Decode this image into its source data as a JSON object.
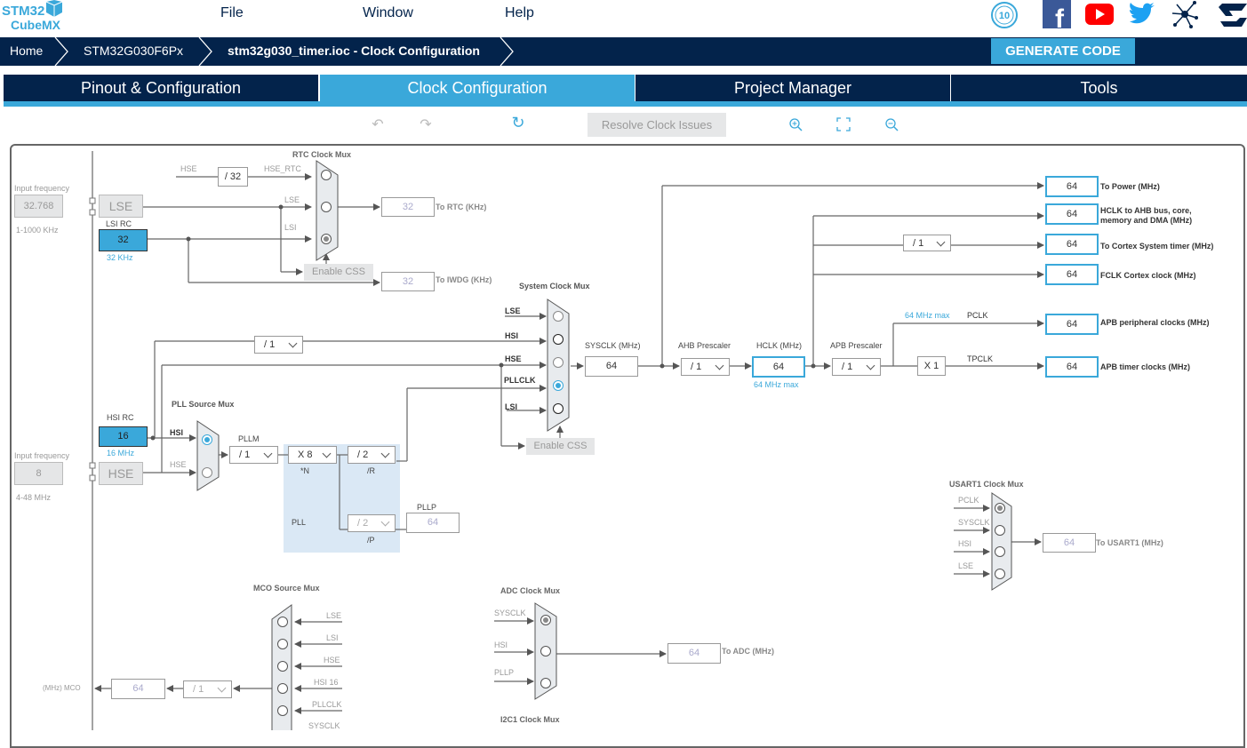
{
  "header": {
    "logo_line1": "STM32",
    "logo_line2": "CubeMX",
    "menu": [
      "File",
      "Window",
      "Help"
    ],
    "social_icons": [
      "anniversary-10-years-icon",
      "facebook-icon",
      "youtube-icon",
      "twitter-icon",
      "network-icon",
      "st-logo-icon"
    ]
  },
  "breadcrumb": [
    "Home",
    "STM32G030F6Px",
    "stm32g030_timer.ioc - Clock Configuration"
  ],
  "generate_code": "GENERATE CODE",
  "tabs": [
    {
      "label": "Pinout & Configuration",
      "active": false
    },
    {
      "label": "Clock Configuration",
      "active": true
    },
    {
      "label": "Project Manager",
      "active": false
    },
    {
      "label": "Tools",
      "active": false
    }
  ],
  "toolbar": {
    "resolve": "Resolve Clock Issues",
    "icons": [
      "undo-icon",
      "redo-icon",
      "refresh-icon",
      "zoom-in-icon",
      "fit-icon",
      "zoom-out-icon"
    ]
  },
  "colors": {
    "navy": "#03234b",
    "accent": "#3aa8da",
    "pll_bg": "#dae8f5"
  },
  "diagram": {
    "lse_in": {
      "label": "Input frequency",
      "value": "32.768",
      "range": "1-1000 KHz",
      "source": "LSE"
    },
    "lsi": {
      "label": "LSI RC",
      "value": "32",
      "unit": "32 KHz"
    },
    "hsi": {
      "label": "HSI RC",
      "value": "16",
      "unit": "16 MHz"
    },
    "hse_in": {
      "label": "Input frequency",
      "value": "8",
      "range": "4-48 MHz",
      "source": "HSE"
    },
    "rtc": {
      "title": "RTC Clock Mux",
      "hse": "HSE",
      "div": "/ 32",
      "hse_rtc": "HSE_RTC",
      "lse": "LSE",
      "lsi": "LSI",
      "enable_css": "Enable CSS",
      "rtc_value": "32",
      "rtc_label": "To RTC (KHz)",
      "iwdg_value": "32",
      "iwdg_label": "To IWDG (KHz)",
      "selected": "LSI"
    },
    "sysmux": {
      "title": "System Clock Mux",
      "inputs": [
        "LSE",
        "HSI",
        "HSE",
        "PLLCLK",
        "LSI"
      ],
      "selected": "PLLCLK",
      "hsi_div": "/ 1",
      "enable_css": "Enable CSS"
    },
    "pllsrc": {
      "title": "PLL Source Mux",
      "inputs": [
        "HSI",
        "HSE"
      ],
      "selected": "HSI"
    },
    "pll": {
      "label": "PLL",
      "pllm_label": "PLLM",
      "pllm": "/ 1",
      "n": "X 8",
      "n_label": "*N",
      "r": "/ 2",
      "r_label": "/R",
      "p": "/ 2",
      "p_label": "/P",
      "pllp_label": "PLLP",
      "pllp_value": "64"
    },
    "sysclk": {
      "label": "SYSCLK (MHz)",
      "value": "64"
    },
    "ahb": {
      "label": "AHB Prescaler",
      "value": "/ 1"
    },
    "hclk": {
      "label": "HCLK (MHz)",
      "value": "64",
      "max": "64 MHz max"
    },
    "apb": {
      "label": "APB Prescaler",
      "value": "/ 1",
      "max": "64 MHz max",
      "pclk": "PCLK",
      "tpclk": "TPCLK",
      "mult": "X 1"
    },
    "cortex_div": "/ 1",
    "outputs": [
      {
        "value": "64",
        "label": "To Power (MHz)"
      },
      {
        "value": "64",
        "label": "HCLK to AHB bus, core, memory and DMA (MHz)"
      },
      {
        "value": "64",
        "label": "To Cortex System timer (MHz)"
      },
      {
        "value": "64",
        "label": "FCLK Cortex clock (MHz)"
      },
      {
        "value": "64",
        "label": "APB peripheral clocks (MHz)"
      },
      {
        "value": "64",
        "label": "APB timer clocks (MHz)"
      }
    ],
    "usart": {
      "title": "USART1 Clock Mux",
      "inputs": [
        "PCLK",
        "SYSCLK",
        "HSI",
        "LSE"
      ],
      "selected": "PCLK",
      "value": "64",
      "label": "To USART1 (MHz)"
    },
    "mco": {
      "title": "MCO Source Mux",
      "inputs": [
        "LSE",
        "LSI",
        "HSE",
        "HSI 16",
        "PLLCLK",
        "SYSCLK"
      ],
      "div": "/ 1",
      "value": "64",
      "label": "(MHz) MCO"
    },
    "adc": {
      "title": "ADC Clock Mux",
      "inputs": [
        "SYSCLK",
        "HSI",
        "PLLP"
      ],
      "selected": "SYSCLK",
      "value": "64",
      "label": "To ADC (MHz)"
    },
    "i2c1": {
      "title": "I2C1 Clock Mux"
    }
  }
}
